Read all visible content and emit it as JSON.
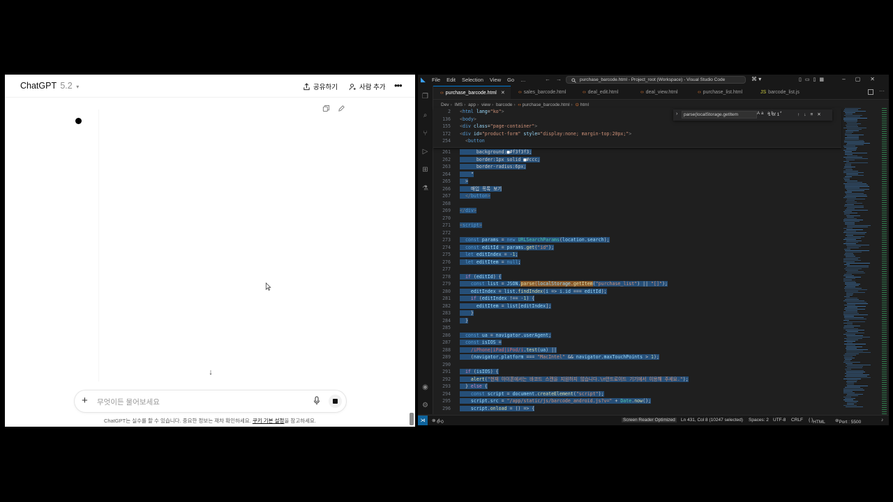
{
  "chatgpt": {
    "brand": "ChatGPT",
    "version": "5.2",
    "share_label": "공유하기",
    "add_people_label": "사람 추가",
    "composer_placeholder": "무엇이든 물어보세요",
    "footer_prefix": "ChatGPT는 실수를 할 수 있습니다. 중요한 정보는 재차 확인하세요. ",
    "footer_link": "쿠키 기본 설정",
    "footer_suffix": "을 참고하세요."
  },
  "vscode": {
    "menu": [
      "File",
      "Edit",
      "Selection",
      "View",
      "Go",
      "…"
    ],
    "command_center": "purchase_barcode.html - Project_root (Workspace) - Visual Studio Code",
    "tabs": [
      {
        "label": "purchase_barcode.html",
        "active": true,
        "type": "html"
      },
      {
        "label": "sales_barcode.html",
        "active": false,
        "type": "html"
      },
      {
        "label": "deal_edit.html",
        "active": false,
        "type": "html"
      },
      {
        "label": "deal_view.html",
        "active": false,
        "type": "html"
      },
      {
        "label": "purchase_list.html",
        "active": false,
        "type": "html"
      },
      {
        "label": "barcode_list.js",
        "active": false,
        "type": "js"
      }
    ],
    "breadcrumbs": [
      "Dev",
      "IMS",
      "app",
      "view",
      "barcode",
      "purchase_barcode.html",
      "html"
    ],
    "find": {
      "query": "parse(localStorage.getItem",
      "count": "1 of 1"
    },
    "status": {
      "problems": "0",
      "warnings": "0",
      "screen_reader": "Screen Reader Optimized",
      "position": "Ln 431, Col 8 (10247 selected)",
      "spaces": "Spaces: 2",
      "encoding": "UTF-8",
      "eol": "CRLF",
      "language": "HTML",
      "port": "Port : 5500"
    }
  }
}
